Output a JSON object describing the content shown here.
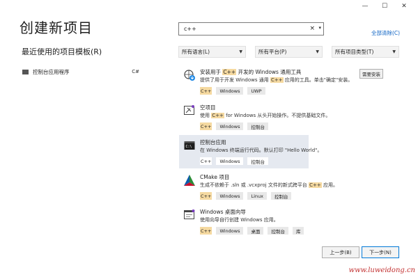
{
  "window": {
    "minimize": "—",
    "maximize": "☐",
    "close": "✕"
  },
  "page_title": "创建新项目",
  "recent": {
    "title": "最近使用的项目模板(R)",
    "items": [
      {
        "label": "控制台应用程序",
        "lang": "C#"
      }
    ]
  },
  "search": {
    "value": "c++",
    "clear": "×",
    "dropdown": "▾"
  },
  "clear_all": "全部清除(C)",
  "filters": {
    "language": "所有语言(L)",
    "platform": "所有平台(P)",
    "project_type": "所有项目类型(T)"
  },
  "templates": [
    {
      "name_pre": "安装用于 ",
      "name_hl": "C++",
      "name_post": " 开发的 Windows 通用工具",
      "desc_pre": "提供了用于开发 Windows 通用 ",
      "desc_hl": "C++",
      "desc_post": " 应用的工具。单击\"确定\"安装。",
      "tags": [
        "C++",
        "Windows",
        "UWP"
      ],
      "install_label": "需要安装",
      "icon": "install-tools-icon"
    },
    {
      "name": "空项目",
      "desc_pre": "使用 ",
      "desc_hl": "C++",
      "desc_post": " for Windows 从头开始操作。不提供基础文件。",
      "tags": [
        "C++",
        "Windows",
        "控制台"
      ],
      "icon": "empty-project-icon"
    },
    {
      "name": "控制台应用",
      "desc": "在 Windows 终端运行代码。默认打印 \"Hello World\"。",
      "tags": [
        "C++",
        "Windows",
        "控制台"
      ],
      "icon": "console-app-icon"
    },
    {
      "name": "CMake 项目",
      "desc_pre": "生成不依赖于 .sln 或 .vcxproj 文件的新式跨平台 ",
      "desc_hl": "C++",
      "desc_post": " 应用。",
      "tags": [
        "C++",
        "Windows",
        "Linux",
        "控制台"
      ],
      "icon": "cmake-icon"
    },
    {
      "name": "Windows 桌面向导",
      "desc": "使用向导自行创建 Windows 应用。",
      "tags": [
        "C++",
        "Windows",
        "桌面",
        "控制台",
        "库"
      ],
      "icon": "desktop-wizard-icon"
    }
  ],
  "buttons": {
    "back": "上一步(B)",
    "next": "下一步(N)"
  },
  "watermark": "www.luweidong.cn",
  "colors": {
    "accent": "#0078d7",
    "link": "#0e63c4",
    "highlight": "#f5d9a0",
    "selected_bg": "#e5e9f0"
  }
}
